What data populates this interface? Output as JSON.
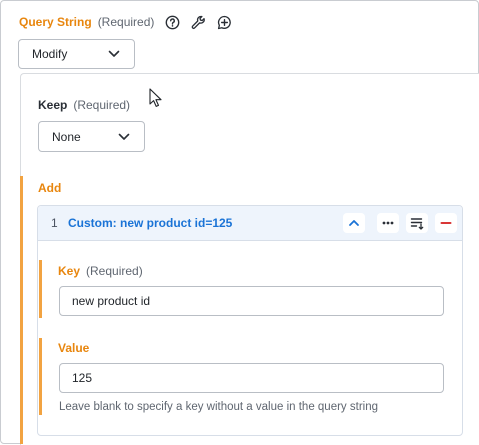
{
  "query_string": {
    "title": "Query String",
    "required": "(Required)",
    "icons": [
      "help-icon",
      "wrench-icon",
      "add-comment-icon"
    ],
    "mode_value": "Modify"
  },
  "keep": {
    "title": "Keep",
    "required": "(Required)",
    "value": "None"
  },
  "add": {
    "title": "Add",
    "items": [
      {
        "index": "1",
        "title": "Custom: new product id=125",
        "key": {
          "label": "Key",
          "required": "(Required)",
          "value": "new product id"
        },
        "value": {
          "label": "Value",
          "value": "125",
          "hint": "Leave blank to specify a key without a value in the query string"
        }
      }
    ]
  },
  "colors": {
    "accent_orange": "#e8860e",
    "link_blue": "#1a73d6",
    "remove_red": "#d93636",
    "header_bg": "#eef4fc"
  }
}
